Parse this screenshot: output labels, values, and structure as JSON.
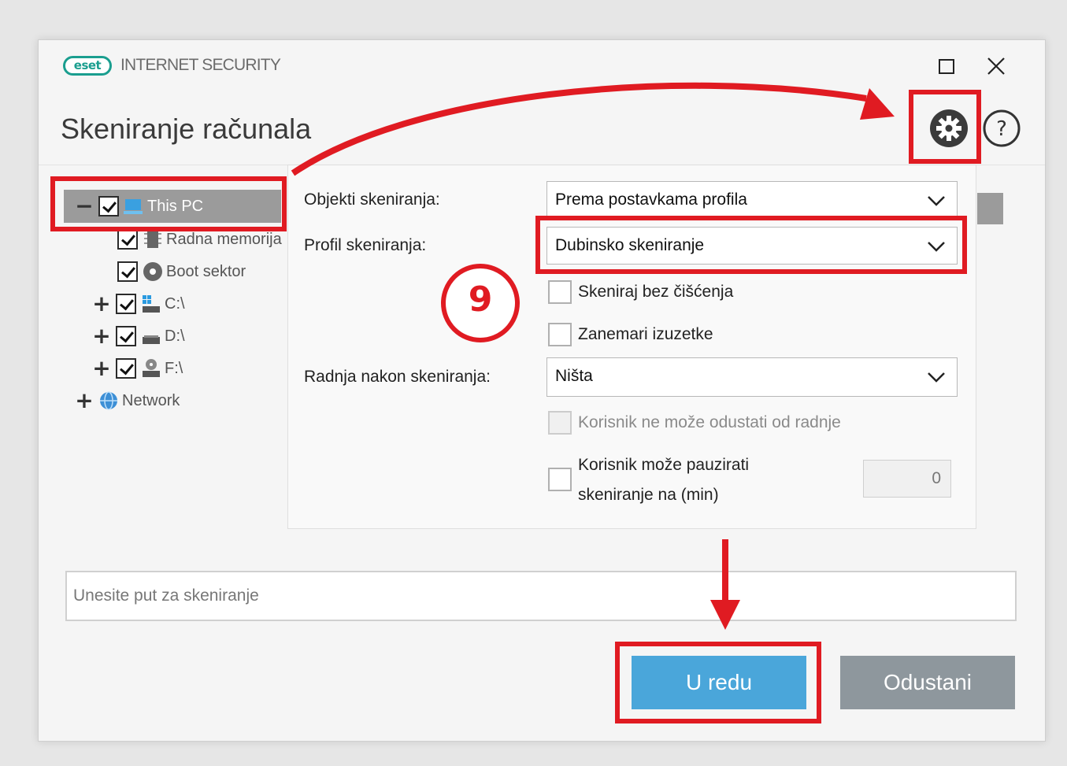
{
  "app": {
    "logo_text": "eset",
    "name": "INTERNET SECURITY",
    "maximize_label": "□",
    "close_label": "✕"
  },
  "page": {
    "title": "Skeniranje računala"
  },
  "tree": {
    "items": [
      {
        "label": "This PC",
        "checked": true,
        "expander": "−",
        "icon": "computer-icon",
        "selected": true
      },
      {
        "label": "Radna memorija",
        "checked": true,
        "expander": "",
        "icon": "memory-icon"
      },
      {
        "label": "Boot sektor",
        "checked": true,
        "expander": "",
        "icon": "disc-icon"
      },
      {
        "label": "C:\\",
        "checked": true,
        "expander": "+",
        "icon": "windows-drive-icon"
      },
      {
        "label": "D:\\",
        "checked": true,
        "expander": "+",
        "icon": "drive-icon"
      },
      {
        "label": "F:\\",
        "checked": true,
        "expander": "+",
        "icon": "cd-drive-icon"
      },
      {
        "label": "Network",
        "checked": false,
        "expander": "+",
        "icon": "network-icon"
      }
    ]
  },
  "form": {
    "scan_targets_label": "Objekti skeniranja:",
    "scan_targets_value": "Prema postavkama profila",
    "scan_profile_label": "Profil skeniranja:",
    "scan_profile_value": "Dubinsko skeniranje",
    "scan_no_clean_label": "Skeniraj bez čišćenja",
    "ignore_exclusions_label": "Zanemari izuzetke",
    "after_scan_label": "Radnja nakon skeniranja:",
    "after_scan_value": "Ništa",
    "user_cannot_cancel_label": "Korisnik ne može odustati od radnje",
    "user_can_pause_line1": "Korisnik može pauzirati",
    "user_can_pause_line2": "skeniranje na (min)",
    "pause_minutes_value": "0"
  },
  "path_input": {
    "placeholder": "Unesite put za skeniranje"
  },
  "buttons": {
    "ok_label": "U redu",
    "cancel_label": "Odustani"
  },
  "annotation": {
    "step_number": "9"
  },
  "colors": {
    "ok_button": "#4aa6da",
    "cancel_button": "#8e979d",
    "highlight": "#e01b22",
    "eset_teal": "#1a9e8f"
  }
}
